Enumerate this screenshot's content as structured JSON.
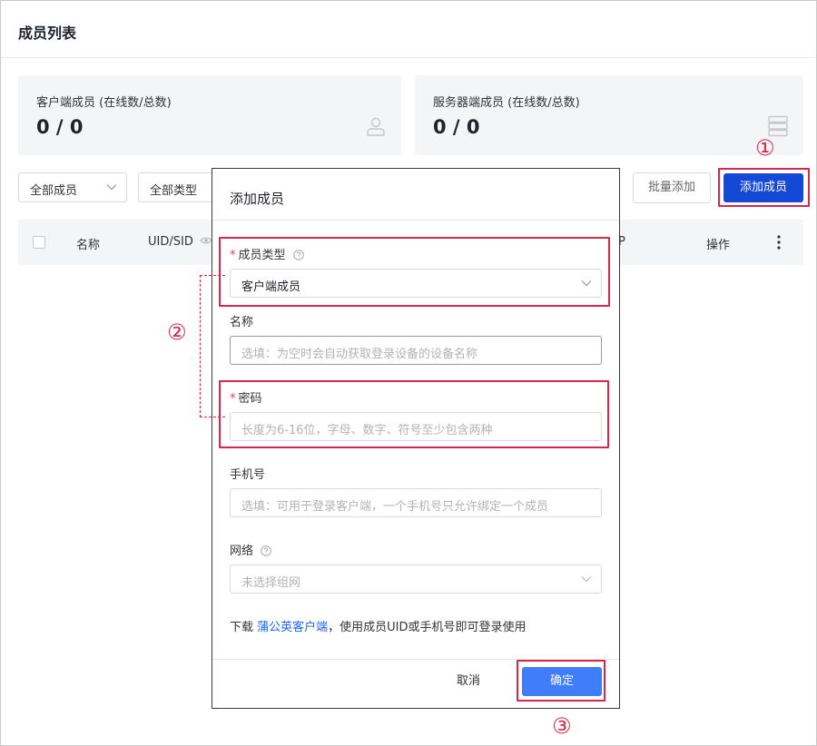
{
  "page": {
    "title": "成员列表"
  },
  "stats": [
    {
      "label": "客户端成员 (在线数/总数)",
      "value": "0 / 0",
      "icon": "user-icon"
    },
    {
      "label": "服务器端成员 (在线数/总数)",
      "value": "0 / 0",
      "icon": "server-icon"
    }
  ],
  "filters": {
    "members": "全部成员",
    "types": "全部类型"
  },
  "toolbar": {
    "batch_add": "批量添加",
    "add_member": "添加成员"
  },
  "table": {
    "headers": {
      "name": "名称",
      "uid": "UID/SID",
      "p": "P",
      "op": "操作"
    }
  },
  "dialog": {
    "title": "添加成员",
    "member_type": {
      "label": "成员类型",
      "value": "客户端成员"
    },
    "name": {
      "label": "名称",
      "placeholder": "选填：为空时会自动获取登录设备的设备名称"
    },
    "password": {
      "label": "密码",
      "placeholder": "长度为6-16位，字母、数字、符号至少包含两种"
    },
    "phone": {
      "label": "手机号",
      "placeholder": "选填：可用于登录客户端，一个手机号只允许绑定一个成员"
    },
    "network": {
      "label": "网络",
      "placeholder": "未选择组网"
    },
    "download": {
      "prefix": "下载 ",
      "link": "蒲公英客户端",
      "suffix": "，使用成员UID或手机号即可登录使用"
    },
    "cancel": "取消",
    "confirm": "确定"
  },
  "callouts": {
    "one": "①",
    "two": "②",
    "three": "③"
  },
  "colors": {
    "primary": "#1448d6",
    "confirm": "#3f7dfa",
    "highlight": "#d9264b",
    "link": "#1664ff"
  }
}
